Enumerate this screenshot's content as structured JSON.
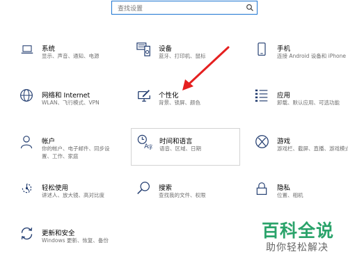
{
  "search": {
    "placeholder": "查找设置"
  },
  "tiles": [
    {
      "title": "系统",
      "desc": "显示、声音、通知、电源"
    },
    {
      "title": "设备",
      "desc": "蓝牙、打印机、鼠标"
    },
    {
      "title": "手机",
      "desc": "连接 Android 设备和 iPhone"
    },
    {
      "title": "网络和 Internet",
      "desc": "WLAN、飞行模式、VPN"
    },
    {
      "title": "个性化",
      "desc": "背景、锁屏、颜色"
    },
    {
      "title": "应用",
      "desc": "卸载、默认应用、可选功能"
    },
    {
      "title": "帐户",
      "desc": "你的帐户、电子邮件、同步设置、工作、家庭"
    },
    {
      "title": "时间和语言",
      "desc": "语音、区域、日期"
    },
    {
      "title": "游戏",
      "desc": "游戏栏、截屏、直播、游戏模式"
    },
    {
      "title": "轻松使用",
      "desc": "讲述人、放大镜、高对比度"
    },
    {
      "title": "搜索",
      "desc": "查找我的文件、权限"
    },
    {
      "title": "隐私",
      "desc": "位置、相机"
    },
    {
      "title": "更新和安全",
      "desc": "Windows 更新、恢复、备份"
    }
  ],
  "watermark": {
    "main": "百科全说",
    "sub": "助你轻松解决"
  },
  "colors": {
    "accent": "#1a73d1",
    "arrow": "#e52020",
    "watermark": "#2aa36a"
  }
}
